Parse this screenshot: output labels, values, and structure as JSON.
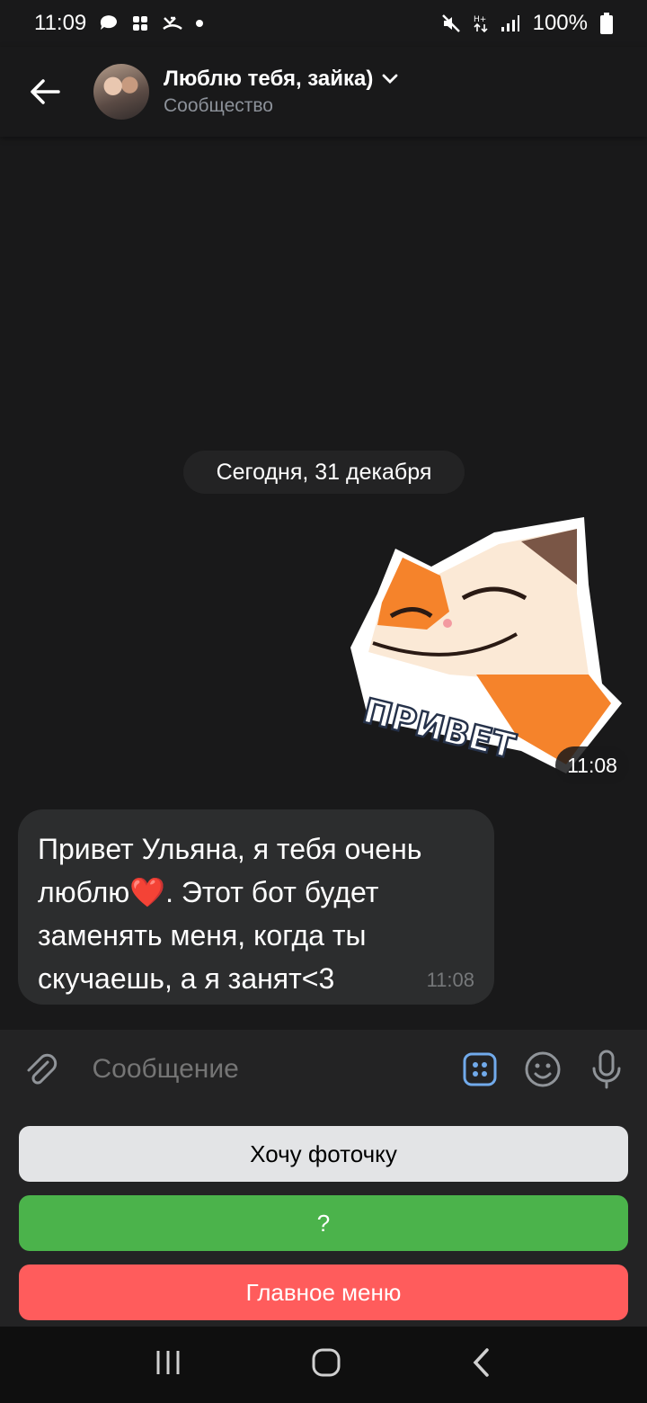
{
  "status_bar": {
    "time": "11:09",
    "battery": "100%",
    "icons": [
      "chat-icon",
      "grid-icon",
      "missed-call-icon",
      "dot",
      "mute-icon",
      "data-icon",
      "signal-icon",
      "battery-icon"
    ]
  },
  "header": {
    "title": "Люблю тебя, зайка)",
    "subtitle": "Сообщество",
    "back_icon": "arrow-left-icon",
    "dropdown_icon": "chevron-down-icon"
  },
  "messages": {
    "date": "Сегодня, 31 декабря",
    "sticker": {
      "caption": "ПРИВЕТ",
      "time": "11:08"
    },
    "incoming": {
      "text_before": "Привет Ульяна, я тебя очень люблю",
      "emoji": "❤️",
      "text_after": ". Этот бот будет заменять меня, когда ты скучаешь, а я занят<3",
      "time": "11:08"
    }
  },
  "composer": {
    "placeholder": "Сообщение",
    "attach_icon": "paperclip-icon",
    "keyboard_icon": "bot-keyboard-icon",
    "emoji_icon": "smile-icon",
    "mic_icon": "microphone-icon",
    "accent_color": "#71aaeb"
  },
  "bot_keyboard": [
    {
      "label": "Хочу фоточку",
      "color": "#e3e4e6"
    },
    {
      "label": "?",
      "color": "#4bb34b"
    },
    {
      "label": "Главное меню",
      "color": "#ff5c5c"
    }
  ],
  "nav_bar": {
    "icons": [
      "recents-icon",
      "home-icon",
      "back-icon"
    ]
  }
}
